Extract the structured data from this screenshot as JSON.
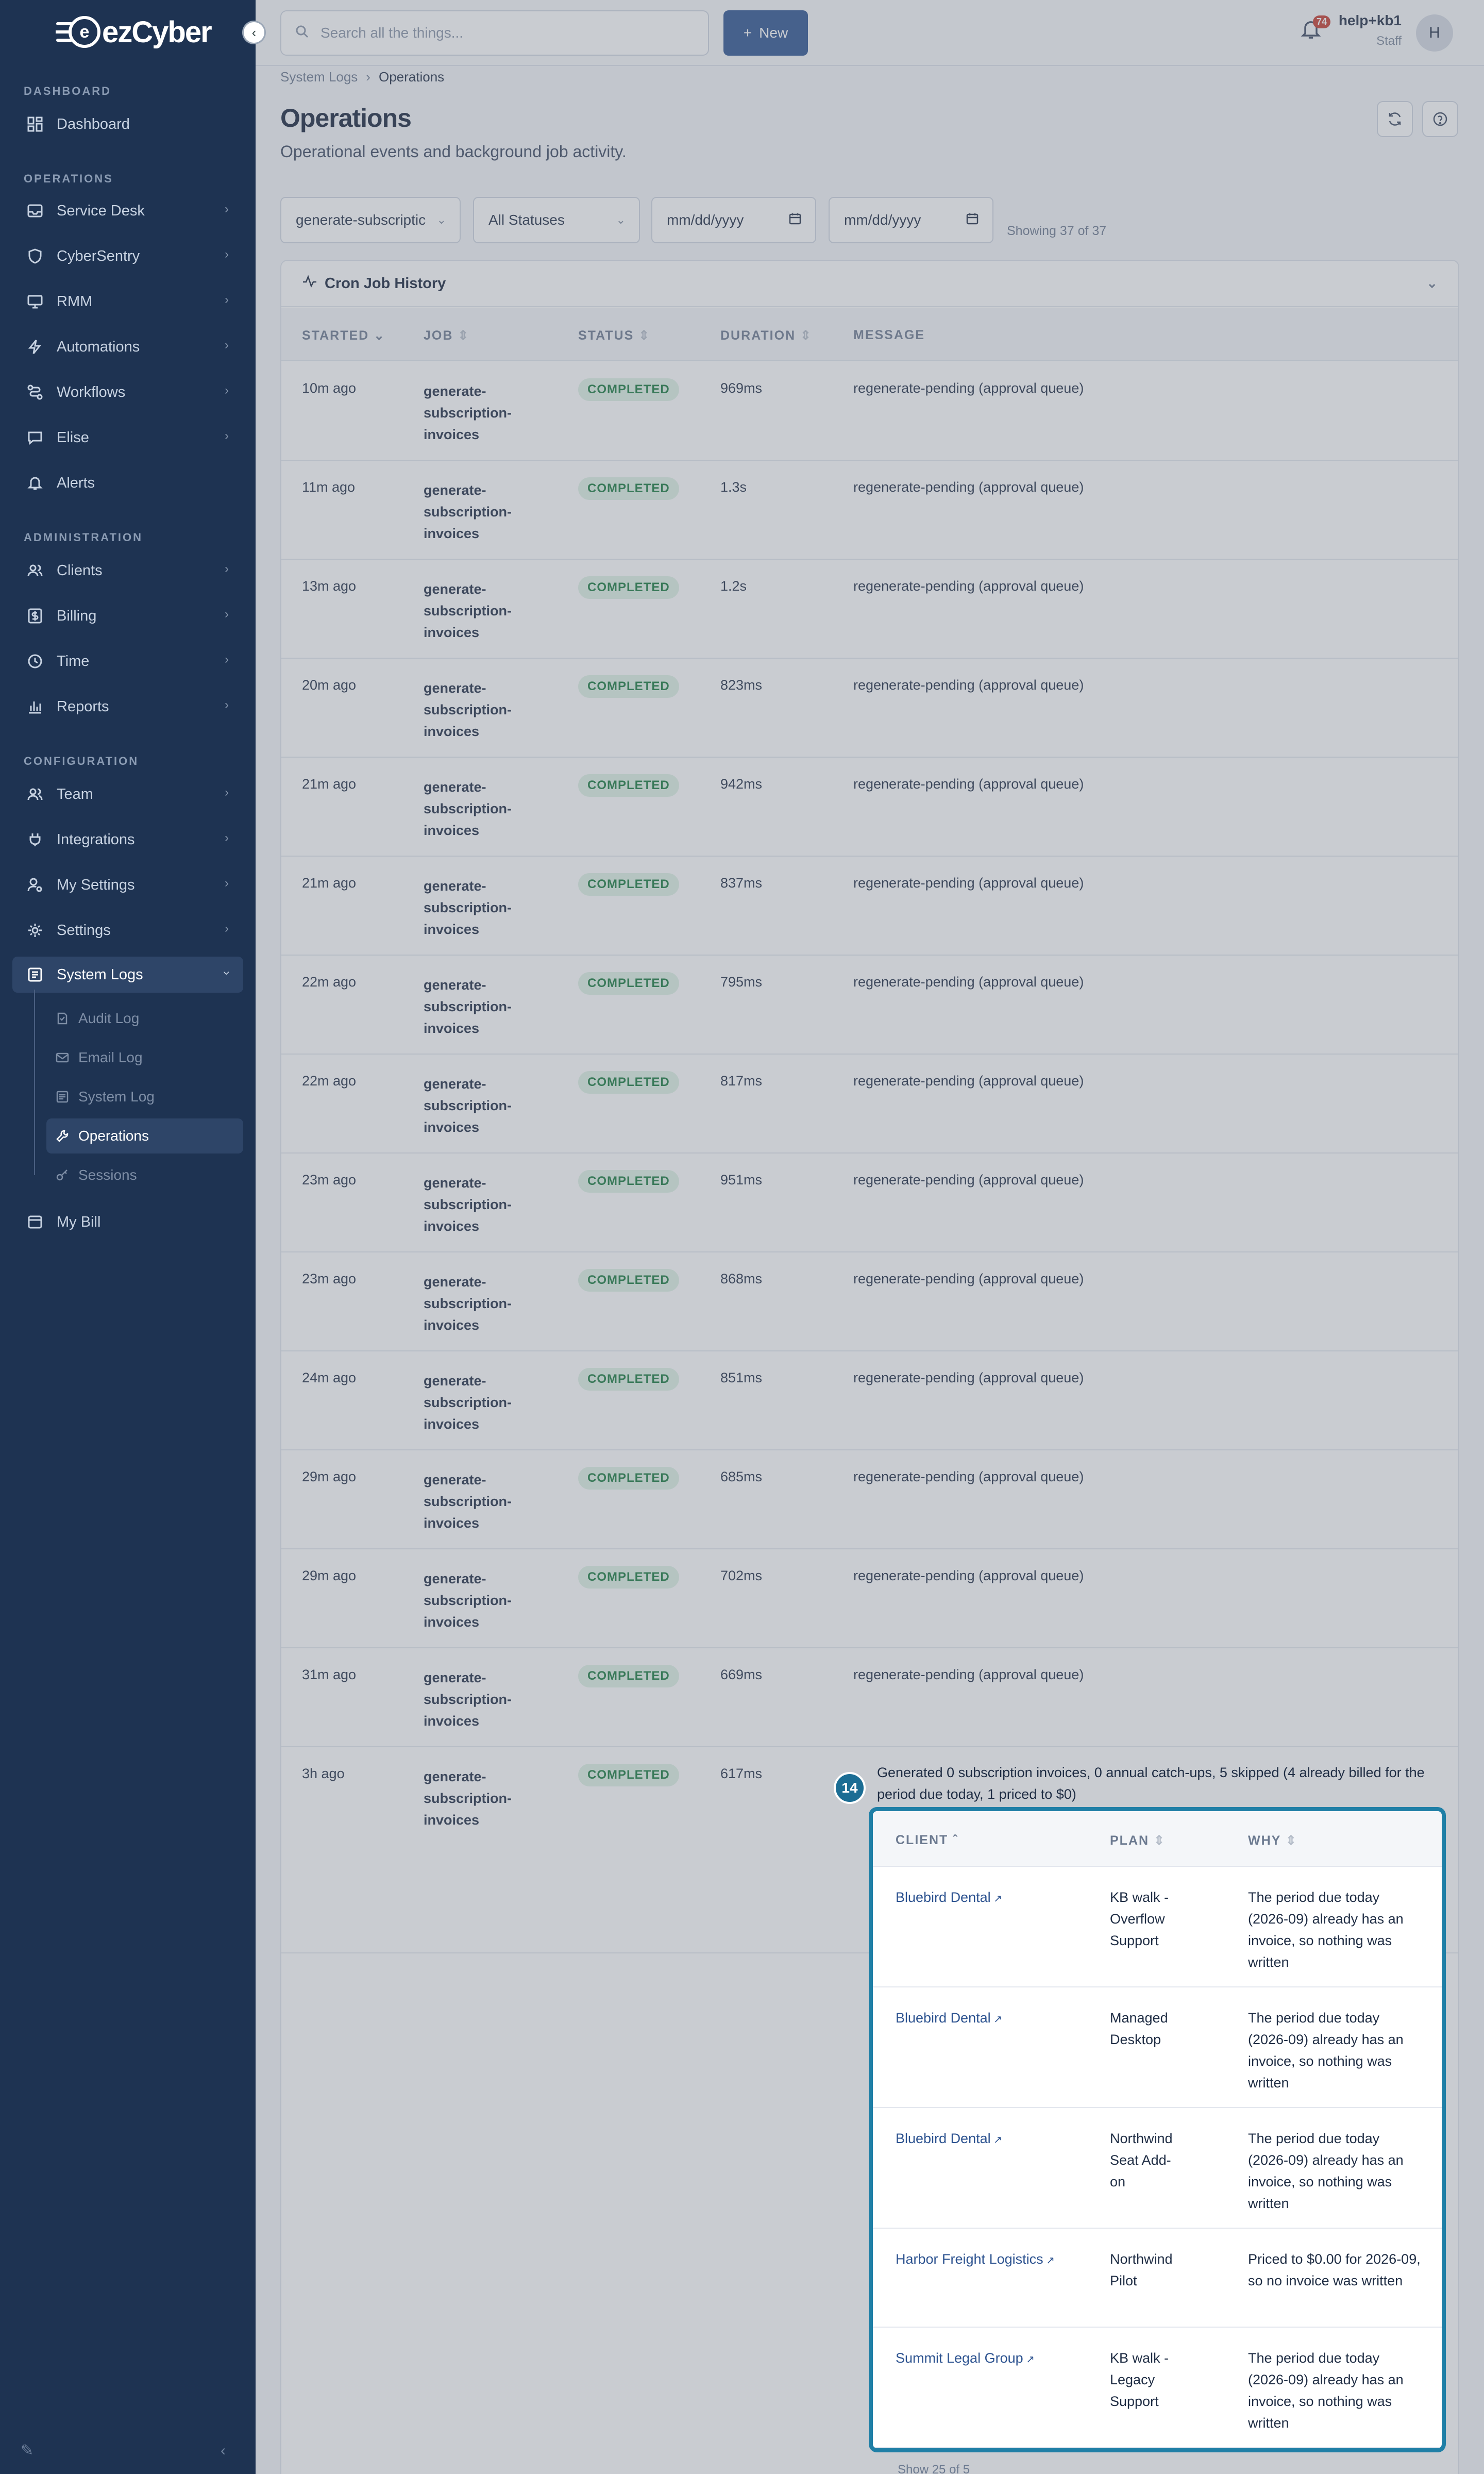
{
  "brand": {
    "name": "ezCyber"
  },
  "search": {
    "placeholder": "Search all the things..."
  },
  "topbar": {
    "new_label": "New",
    "notifications": "74",
    "user_name": "help+kb1",
    "user_role": "Staff",
    "avatar_initial": "H"
  },
  "sidebar": {
    "sections": {
      "dashboard": "DASHBOARD",
      "operations": "OPERATIONS",
      "administration": "ADMINISTRATION",
      "configuration": "CONFIGURATION"
    },
    "items": {
      "dashboard": "Dashboard",
      "service_desk": "Service Desk",
      "cybersentry": "CyberSentry",
      "rmm": "RMM",
      "automations": "Automations",
      "workflows": "Workflows",
      "elise": "Elise",
      "alerts": "Alerts",
      "clients": "Clients",
      "billing": "Billing",
      "time": "Time",
      "reports": "Reports",
      "team": "Team",
      "integrations": "Integrations",
      "my_settings": "My Settings",
      "settings": "Settings",
      "system_logs": "System Logs",
      "my_bill": "My Bill"
    },
    "system_logs_children": {
      "audit_log": "Audit Log",
      "email_log": "Email Log",
      "system_log": "System Log",
      "operations": "Operations",
      "sessions": "Sessions"
    }
  },
  "breadcrumb": {
    "parent": "System Logs",
    "current": "Operations"
  },
  "page": {
    "title": "Operations",
    "subtitle": "Operational events and background job activity."
  },
  "filters": {
    "job": "generate-subscriptic",
    "status": "All Statuses",
    "date_from": "mm/dd/yyyy",
    "date_to": "mm/dd/yyyy",
    "showing": "Showing 37 of 37"
  },
  "card": {
    "title": "Cron Job History"
  },
  "table": {
    "headers": {
      "started": "STARTED",
      "job": "JOB",
      "status": "STATUS",
      "duration": "DURATION",
      "message": "MESSAGE"
    },
    "rows": [
      {
        "started": "10m ago",
        "job": "generate-subscription-invoices",
        "status": "COMPLETED",
        "duration": "969ms",
        "message": "regenerate-pending (approval queue)"
      },
      {
        "started": "11m ago",
        "job": "generate-subscription-invoices",
        "status": "COMPLETED",
        "duration": "1.3s",
        "message": "regenerate-pending (approval queue)"
      },
      {
        "started": "13m ago",
        "job": "generate-subscription-invoices",
        "status": "COMPLETED",
        "duration": "1.2s",
        "message": "regenerate-pending (approval queue)"
      },
      {
        "started": "20m ago",
        "job": "generate-subscription-invoices",
        "status": "COMPLETED",
        "duration": "823ms",
        "message": "regenerate-pending (approval queue)"
      },
      {
        "started": "21m ago",
        "job": "generate-subscription-invoices",
        "status": "COMPLETED",
        "duration": "942ms",
        "message": "regenerate-pending (approval queue)"
      },
      {
        "started": "21m ago",
        "job": "generate-subscription-invoices",
        "status": "COMPLETED",
        "duration": "837ms",
        "message": "regenerate-pending (approval queue)"
      },
      {
        "started": "22m ago",
        "job": "generate-subscription-invoices",
        "status": "COMPLETED",
        "duration": "795ms",
        "message": "regenerate-pending (approval queue)"
      },
      {
        "started": "22m ago",
        "job": "generate-subscription-invoices",
        "status": "COMPLETED",
        "duration": "817ms",
        "message": "regenerate-pending (approval queue)"
      },
      {
        "started": "23m ago",
        "job": "generate-subscription-invoices",
        "status": "COMPLETED",
        "duration": "951ms",
        "message": "regenerate-pending (approval queue)"
      },
      {
        "started": "23m ago",
        "job": "generate-subscription-invoices",
        "status": "COMPLETED",
        "duration": "868ms",
        "message": "regenerate-pending (approval queue)"
      },
      {
        "started": "24m ago",
        "job": "generate-subscription-invoices",
        "status": "COMPLETED",
        "duration": "851ms",
        "message": "regenerate-pending (approval queue)"
      },
      {
        "started": "29m ago",
        "job": "generate-subscription-invoices",
        "status": "COMPLETED",
        "duration": "685ms",
        "message": "regenerate-pending (approval queue)"
      },
      {
        "started": "29m ago",
        "job": "generate-subscription-invoices",
        "status": "COMPLETED",
        "duration": "702ms",
        "message": "regenerate-pending (approval queue)"
      },
      {
        "started": "31m ago",
        "job": "generate-subscription-invoices",
        "status": "COMPLETED",
        "duration": "669ms",
        "message": "regenerate-pending (approval queue)"
      },
      {
        "started": "3h ago",
        "job": "generate-subscription-invoices",
        "status": "COMPLETED",
        "duration": "617ms",
        "message": "Generated 0 subscription invoices, 0 annual catch-ups, 5 skipped (4 already billed for the period due today, 1 priced to $0)"
      }
    ]
  },
  "detail": {
    "step": "14",
    "headers": {
      "client": "CLIENT",
      "plan": "PLAN",
      "why": "WHY"
    },
    "rows": [
      {
        "client": "Bluebird Dental",
        "plan": "KB walk - Overflow Support",
        "why": "The period due today (2026-09) already has an invoice, so nothing was written"
      },
      {
        "client": "Bluebird Dental",
        "plan": "Managed Desktop",
        "why": "The period due today (2026-09) already has an invoice, so nothing was written"
      },
      {
        "client": "Bluebird Dental",
        "plan": "Northwind Seat Add-on",
        "why": "The period due today (2026-09) already has an invoice, so nothing was written"
      },
      {
        "client": "Harbor Freight Logistics",
        "plan": "Northwind Pilot",
        "why": "Priced to $0.00 for 2026-09, so no invoice was written"
      },
      {
        "client": "Summit Legal Group",
        "plan": "KB walk - Legacy Support",
        "why": "The period due today (2026-09) already has an invoice, so nothing was written"
      }
    ],
    "pager": "Show  25  of 5"
  },
  "colors": {
    "sidebar": "#1e3352",
    "primary": "#2d5390",
    "accent": "#1f7fa6",
    "success_bg": "#dff3e6",
    "success_text": "#187a3e"
  }
}
